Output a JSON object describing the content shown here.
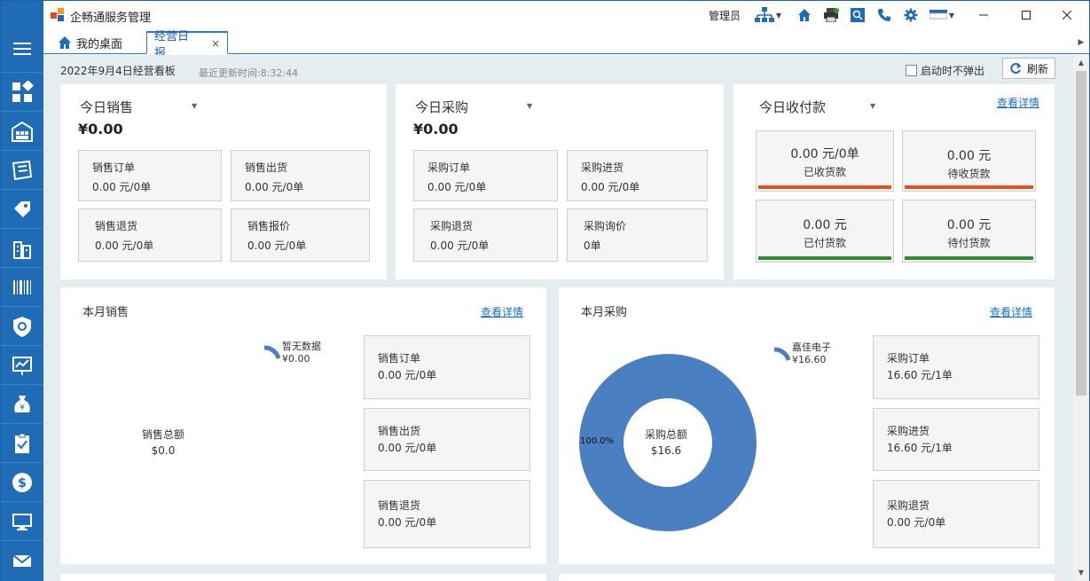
{
  "app": {
    "title": "企畅通服务管理",
    "user": "管理员"
  },
  "tabs": {
    "home": "我的桌面",
    "active": "经营日报",
    "close": "×"
  },
  "header": {
    "date_title": "2022年9月4日经营看板",
    "last_update": "最近更新时间:8:32:44",
    "no_popup_label": "启动时不弹出",
    "refresh_label": "刷新"
  },
  "today_sales": {
    "title": "今日销售",
    "amount": "¥0.00",
    "boxes": [
      {
        "label": "销售订单",
        "value": "0.00 元/0单"
      },
      {
        "label": "销售出货",
        "value": "0.00 元/0单"
      },
      {
        "label": "销售退货",
        "value": "0.00 元/0单"
      },
      {
        "label": "销售报价",
        "value": "0.00 元/0单"
      }
    ]
  },
  "today_purchase": {
    "title": "今日采购",
    "amount": "¥0.00",
    "boxes": [
      {
        "label": "采购订单",
        "value": "0.00 元/0单"
      },
      {
        "label": "采购进货",
        "value": "0.00 元/0单"
      },
      {
        "label": "采购退货",
        "value": "0.00 元/0单"
      },
      {
        "label": "采购询价",
        "value": "0单"
      }
    ]
  },
  "today_payments": {
    "title": "今日收付款",
    "link": "查看详情",
    "boxes": [
      {
        "value": "0.00 元/0单",
        "label": "已收货款",
        "bar_color": "#e0531f"
      },
      {
        "value": "0.00 元",
        "label": "待收货款",
        "bar_color": "#e0531f"
      },
      {
        "value": "0.00 元",
        "label": "已付货款",
        "bar_color": "#2e8b2e"
      },
      {
        "value": "0.00 元",
        "label": "待付货款",
        "bar_color": "#2e8b2e"
      }
    ]
  },
  "month_sales": {
    "title": "本月销售",
    "link": "查看详情",
    "legend_name": "暂无数据",
    "legend_value": "¥0.00",
    "center_label": "销售总额",
    "center_value": "$0.0",
    "boxes": [
      {
        "label": "销售订单",
        "value": "0.00 元/0单"
      },
      {
        "label": "销售出货",
        "value": "0.00 元/0单"
      },
      {
        "label": "销售退货",
        "value": "0.00 元/0单"
      }
    ]
  },
  "month_purchase": {
    "title": "本月采购",
    "link": "查看详情",
    "legend_name": "嘉佳电子",
    "legend_value": "¥16.60",
    "center_label": "采购总额",
    "center_value": "$16.6",
    "pct_label": "100.0%",
    "boxes": [
      {
        "label": "采购订单",
        "value": "16.60 元/1单"
      },
      {
        "label": "采购进货",
        "value": "16.60 元/1单"
      },
      {
        "label": "采购退货",
        "value": "0.00 元/0单"
      }
    ]
  },
  "colors": {
    "sidebar": "#1f6bb5",
    "accent": "#1a6fc0",
    "donut": "#4a7fc1",
    "orange_bar": "#e0531f",
    "green_bar": "#2e8b2e"
  },
  "sidebar_icons": [
    "menu-icon",
    "dashboard-icon",
    "warehouse-icon",
    "ticket-icon",
    "price-tag-icon",
    "building-icon",
    "barcode-icon",
    "shield-icon",
    "chart-board-icon",
    "money-bag-icon",
    "clipboard-check-icon",
    "dollar-icon",
    "monitor-icon",
    "mail-icon"
  ]
}
